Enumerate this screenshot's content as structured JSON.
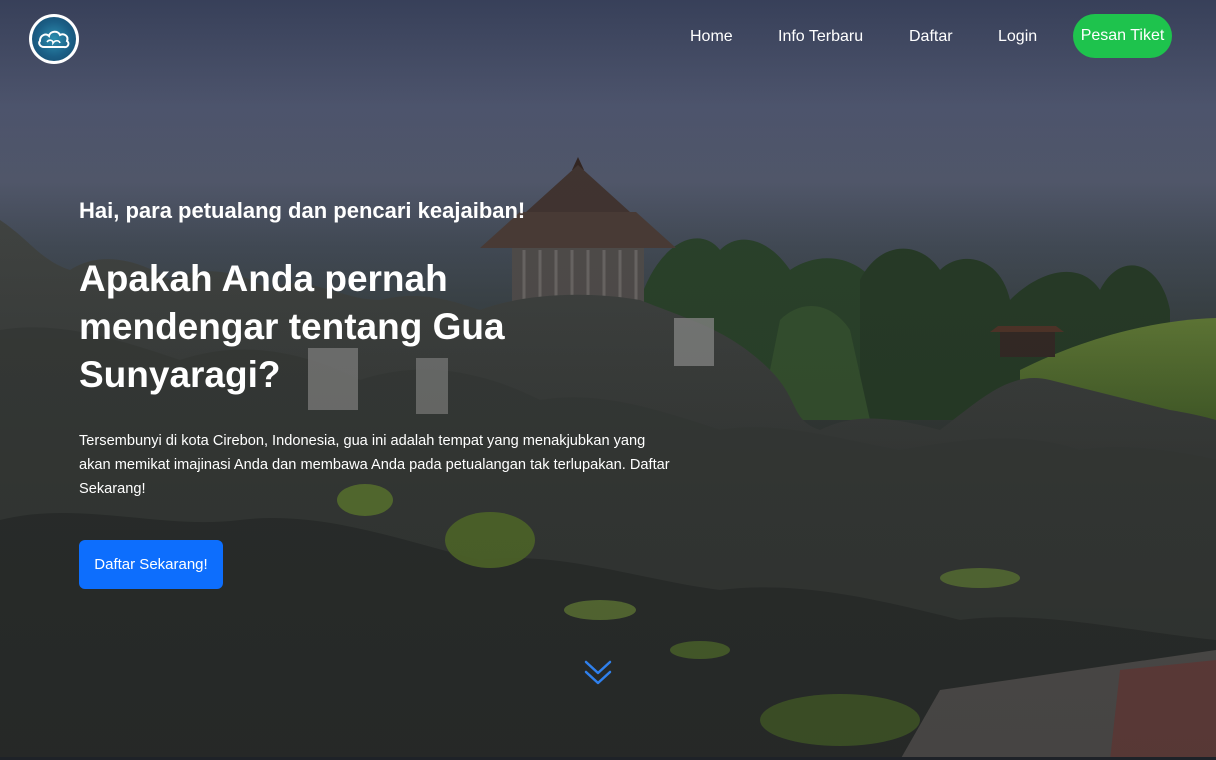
{
  "nav": {
    "logo_icon": "cirebon-cloud-logo-icon",
    "links": [
      {
        "label": "Home"
      },
      {
        "label": "Info Terbaru"
      },
      {
        "label": "Daftar"
      },
      {
        "label": "Login"
      }
    ],
    "cta_label": "Pesan Tiket"
  },
  "hero": {
    "greeting": "Hai, para petualang dan pencari keajaiban!",
    "headline": "Apakah Anda pernah mendengar tentang Gua Sunyaragi?",
    "description": "Tersembunyi di kota Cirebon, Indonesia, gua ini adalah tempat yang menakjubkan yang akan memikat imajinasi Anda dan membawa Anda pada petualangan tak terlupakan. Daftar Sekarang!",
    "button_label": "Daftar Sekarang!",
    "scroll_icon": "double-chevron-down-icon"
  },
  "colors": {
    "ticket_button": "#1ec34d",
    "cta_button": "#0d6efd",
    "scroll_icon": "#2f80ed"
  }
}
